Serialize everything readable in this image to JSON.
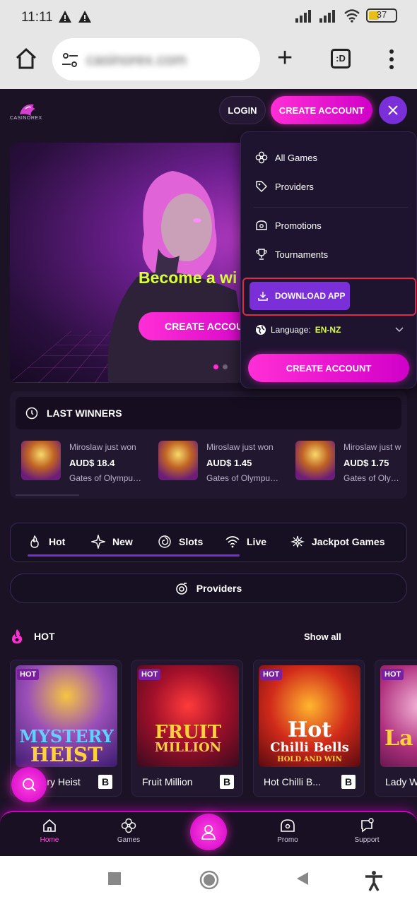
{
  "status_bar": {
    "time": "11:11",
    "battery": "37"
  },
  "browser": {
    "url": "casinorex.com",
    "tabs_icon": ":D"
  },
  "header": {
    "logo_text": "CASINOREX",
    "login_label": "LOGIN",
    "create_account_label": "CREATE ACCOUNT"
  },
  "banner": {
    "title": "Become a wi",
    "cta": "CREATE ACCOUNT"
  },
  "menu": {
    "items": [
      {
        "label": "All Games",
        "icon": "clover-icon"
      },
      {
        "label": "Providers",
        "icon": "tag-icon"
      },
      {
        "label": "Promotions",
        "icon": "promo-icon"
      },
      {
        "label": "Tournaments",
        "icon": "trophy-icon"
      }
    ],
    "download_label": "DOWNLOAD APP",
    "language_label": "Language:",
    "language_value": "EN-NZ",
    "create_account_label": "CREATE ACCOUNT"
  },
  "winners": {
    "title": "LAST WINNERS",
    "items": [
      {
        "who": "Miroslaw just won",
        "amount": "AUD$ 18.4",
        "game": "Gates of Olympus Super Scatter"
      },
      {
        "who": "Miroslaw just won",
        "amount": "AUD$ 1.45",
        "game": "Gates of Olympus Super Scatter"
      },
      {
        "who": "Miroslaw just w",
        "amount": "AUD$ 1.75",
        "game": "Gates of Olymp"
      }
    ]
  },
  "categories": [
    {
      "label": "Hot",
      "icon": "flame-icon"
    },
    {
      "label": "New",
      "icon": "sparkle-icon"
    },
    {
      "label": "Slots",
      "icon": "spiral-icon"
    },
    {
      "label": "Live",
      "icon": "wifi-icon"
    },
    {
      "label": "Jackpot Games",
      "icon": "star-icon"
    }
  ],
  "providers_label": "Providers",
  "hot": {
    "title": "HOT",
    "show_all": "Show all",
    "badge": "HOT",
    "games": [
      {
        "title": "Mystery Heist",
        "art_line1": "MYSTERY",
        "art_line2": "HEIST",
        "provider": "B"
      },
      {
        "title": "Fruit Million",
        "art_line1": "FRUIT",
        "art_line2": "MILLION",
        "provider": "B"
      },
      {
        "title": "Hot Chilli B...",
        "art_line1": "Hot",
        "art_line2": "Chilli Bells",
        "art_line3": "HOLD AND WIN",
        "provider": "B"
      },
      {
        "title": "Lady W",
        "art_line1": "La",
        "provider": ""
      }
    ]
  },
  "bottom_nav": [
    {
      "label": "Home",
      "icon": "home-icon"
    },
    {
      "label": "Games",
      "icon": "clover-icon"
    },
    {
      "label": "",
      "icon": "user-icon"
    },
    {
      "label": "Promo",
      "icon": "promo-icon"
    },
    {
      "label": "Support",
      "icon": "support-icon"
    }
  ],
  "colors": {
    "accent": "#d100c8",
    "purple": "#7a2fd8",
    "highlight": "#d9ff3a",
    "frame_red": "#e0284a"
  }
}
